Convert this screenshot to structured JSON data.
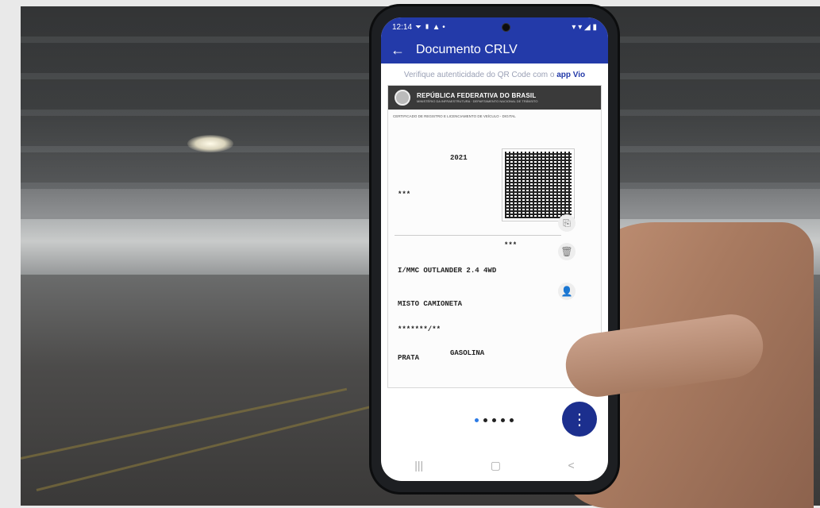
{
  "status_bar": {
    "time": "12:14",
    "left_icons": "⏷ ▮ ▲ •",
    "right_icons": "▾ ▾ ◢ ▮"
  },
  "app": {
    "title": "Documento CRLV",
    "back_icon": "arrow-left-icon"
  },
  "verify": {
    "text": "Verifique autenticidade do QR Code com o",
    "via": "app Vio"
  },
  "document": {
    "header_title": "REPÚBLICA FEDERATIVA DO BRASIL",
    "header_sub": "MINISTÉRIO DA INFRAESTRUTURA · DEPARTAMENTO NACIONAL DE TRÂNSITO",
    "cert_title": "CERTIFICADO DE REGISTRO E LICENCIAMENTO DE VEÍCULO - DIGITAL",
    "year": "2021",
    "masked_1": "***",
    "masked_2": "***",
    "model": "I/MMC OUTLANDER 2.4 4WD",
    "species": "MISTO CAMIONETA",
    "plate_masked": "*******/**",
    "color": "PRATA",
    "fuel": "GASOLINA"
  },
  "pager": {
    "count": 5,
    "active": 0
  },
  "fab_icon": "more-vertical-icon",
  "nav": {
    "recents": "|||",
    "home": "▢",
    "back": "<"
  }
}
